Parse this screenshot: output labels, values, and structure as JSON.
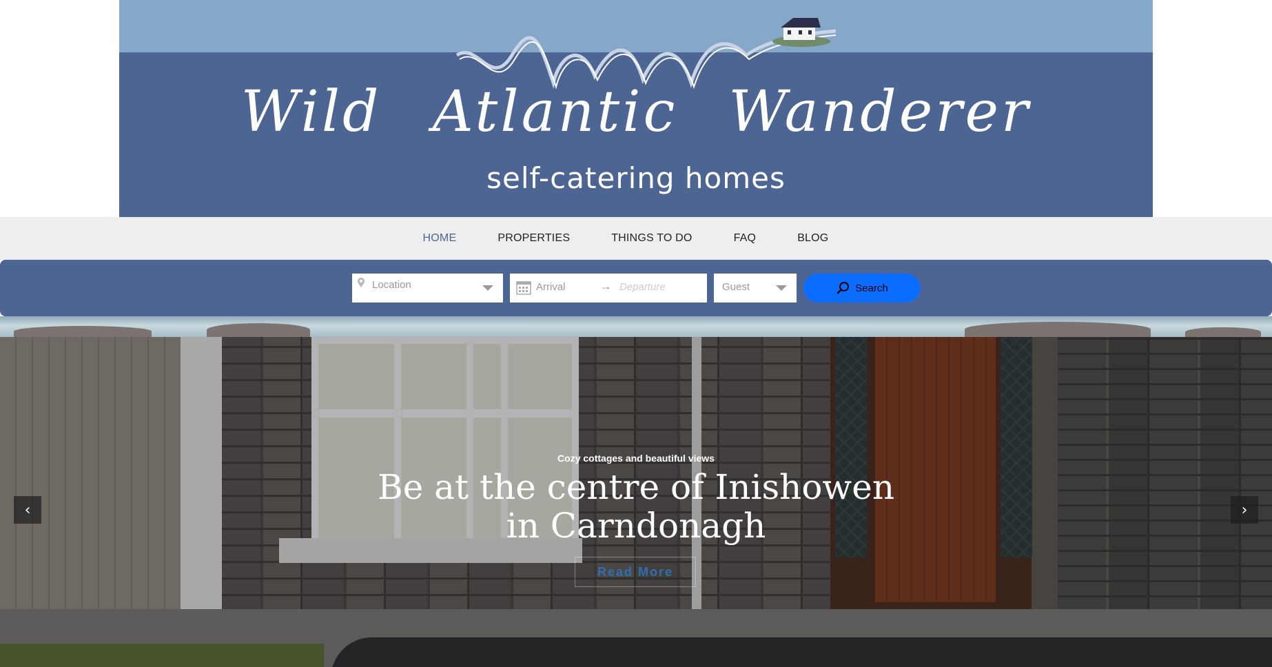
{
  "brand": {
    "title": "Wild Atlantic Wanderer",
    "subtitle": "self-catering homes"
  },
  "nav": {
    "items": [
      {
        "label": "HOME",
        "active": true
      },
      {
        "label": "PROPERTIES",
        "active": false
      },
      {
        "label": "THINGS TO DO",
        "active": false
      },
      {
        "label": "FAQ",
        "active": false
      },
      {
        "label": "BLOG",
        "active": false
      }
    ]
  },
  "search": {
    "location_placeholder": "Location",
    "arrival_placeholder": "Arrival",
    "departure_placeholder": "Departure",
    "guest_placeholder": "Guest",
    "button_label": "Search",
    "icons": {
      "location": "map-pin-icon",
      "calendar": "calendar-icon",
      "arrow": "arrow-right-icon",
      "dropdown": "chevron-down-icon",
      "search": "search-icon"
    }
  },
  "hero": {
    "eyebrow": "Cozy cottages and beautiful views",
    "title_line1": "Be at the centre of Inishowen",
    "title_line2": "in Carndonagh",
    "cta_label": "Read More",
    "prev_icon": "‹",
    "next_icon": "›"
  },
  "colors": {
    "brand_blue": "#4d6592",
    "sky_blue": "#86a8c8",
    "search_button": "#0a6dff",
    "nav_background": "#eeeeee"
  }
}
